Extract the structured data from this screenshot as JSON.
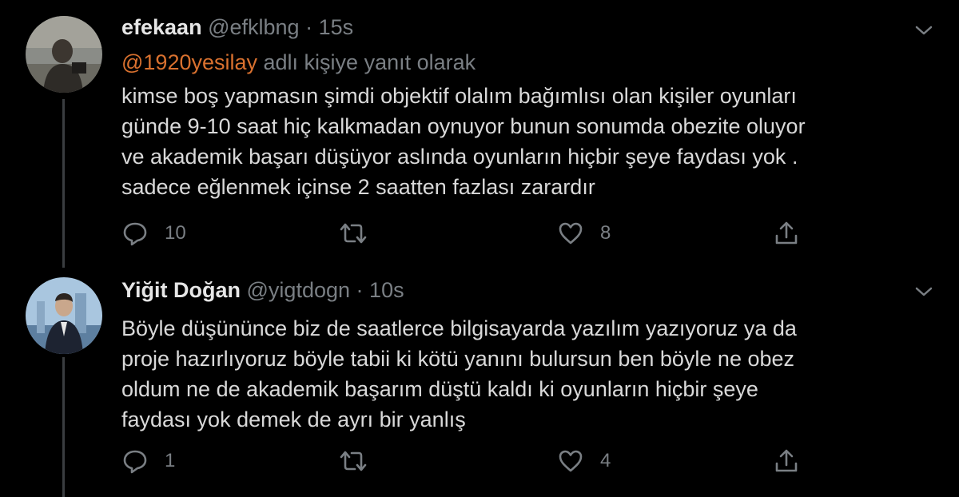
{
  "colors": {
    "background": "#000000",
    "text": "#d9d9d9",
    "secondary": "#7a7f84",
    "mention": "#d9712f",
    "thread_line": "#3a3d40"
  },
  "tweets": [
    {
      "display_name": "efekaan",
      "handle": "@efklbng",
      "separator": "·",
      "time": "15s",
      "reply_mention": "@1920yesilay",
      "reply_suffix": " adlı kişiye yanıt olarak",
      "body_lines": [
        "kimse boş yapmasın şimdi objektif olalım bağımlısı olan kişiler oyunları",
        "günde 9-10 saat hiç kalkmadan oynuyor bunun sonumda obezite oluyor",
        "ve akademik başarı düşüyor aslında oyunların hiçbir şeye faydası yok .",
        "sadece eğlenmek içinse 2 saatten fazlası zarardır"
      ],
      "replies": "10",
      "retweets": "",
      "likes": "8",
      "icons": {
        "reply": "reply-icon",
        "retweet": "retweet-icon",
        "like": "heart-icon",
        "share": "share-icon",
        "menu": "chevron-down-icon"
      }
    },
    {
      "display_name": "Yiğit Doğan",
      "handle": "@yigtdogn",
      "separator": "·",
      "time": "10s",
      "body_lines": [
        "Böyle düşününce biz de saatlerce bilgisayarda yazılım yazıyoruz ya da",
        "proje hazırlıyoruz böyle tabii ki kötü yanını bulursun  ben böyle ne obez",
        "oldum ne de akademik başarım düştü kaldı ki oyunların hiçbir şeye",
        "faydası yok demek de ayrı bir yanlış"
      ],
      "replies": "1",
      "retweets": "",
      "likes": "4",
      "icons": {
        "reply": "reply-icon",
        "retweet": "retweet-icon",
        "like": "heart-icon",
        "share": "share-icon",
        "menu": "chevron-down-icon"
      }
    }
  ]
}
